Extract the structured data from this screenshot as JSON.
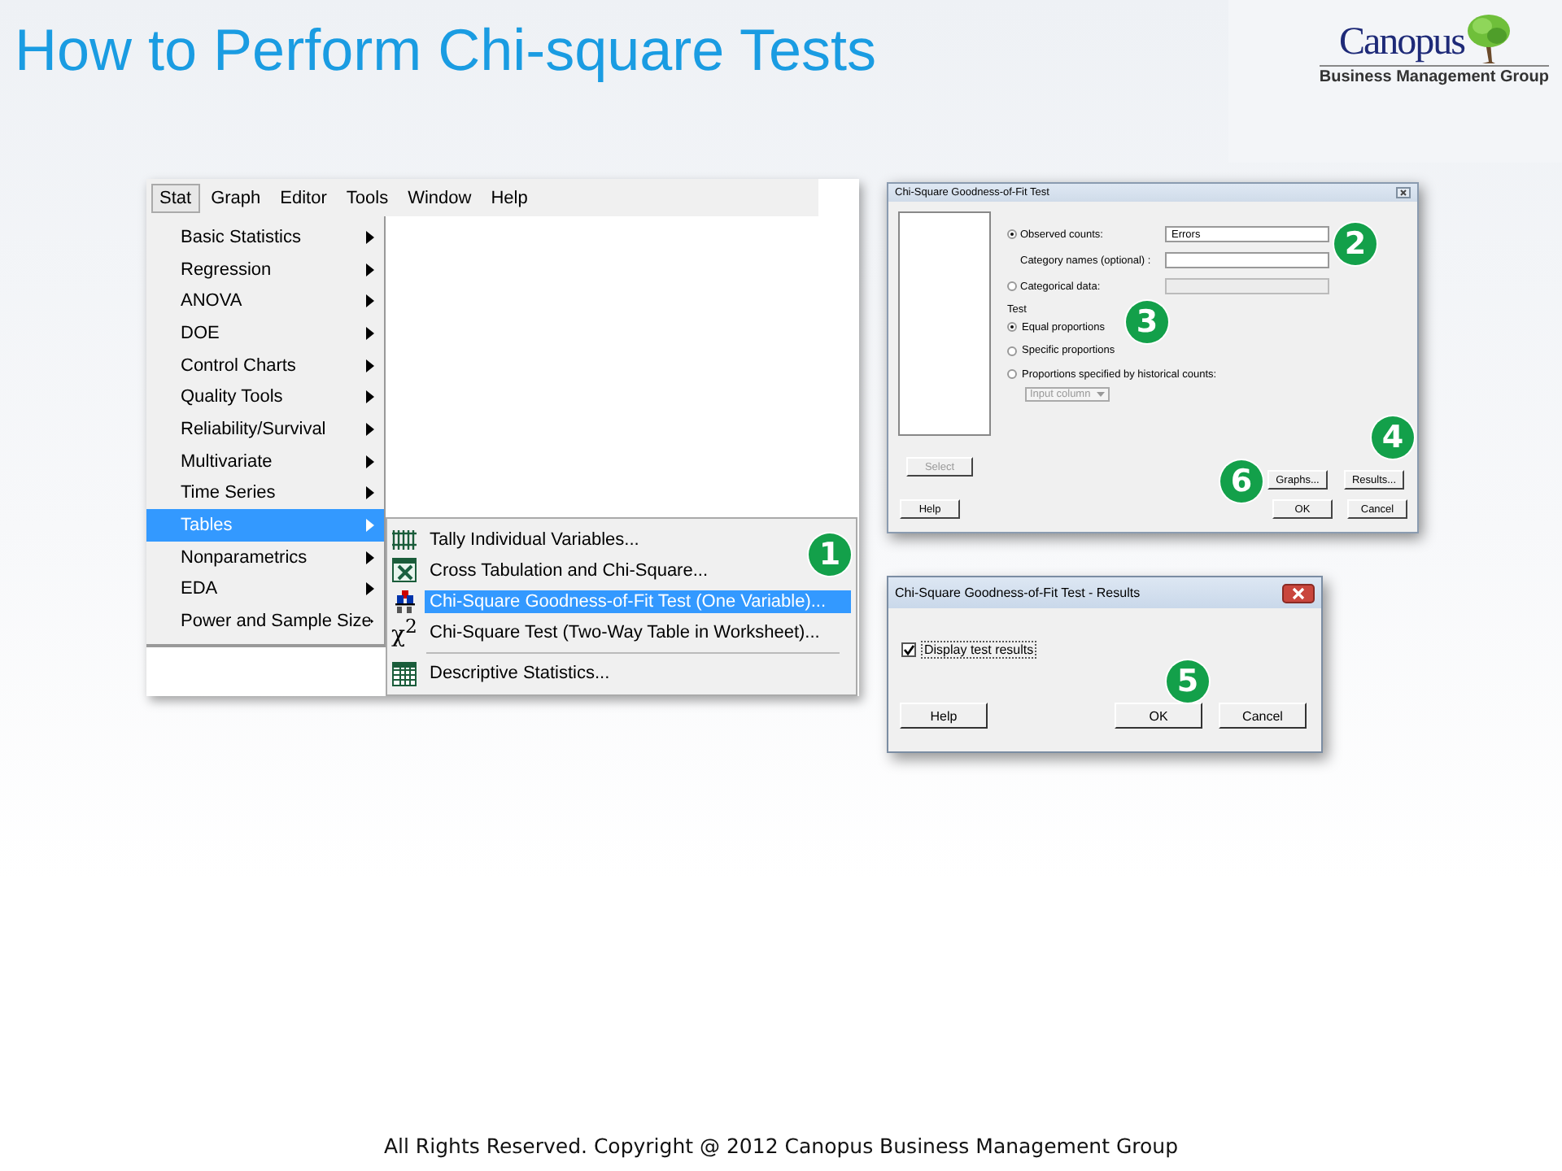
{
  "slide": {
    "title": "How to Perform Chi-square Tests",
    "logo": {
      "name": "Canopus",
      "tagline": "Business Management Group"
    },
    "footer": "All Rights Reserved. Copyright @ 2012  Canopus Business Management Group"
  },
  "menu_window": {
    "menubar": [
      {
        "label": "Stat",
        "selected": true
      },
      {
        "label": "Graph",
        "selected": false
      },
      {
        "label": "Editor",
        "selected": false
      },
      {
        "label": "Tools",
        "selected": false
      },
      {
        "label": "Window",
        "selected": false
      },
      {
        "label": "Help",
        "selected": false
      }
    ],
    "menu_items": [
      {
        "label": "Basic Statistics",
        "selected": false
      },
      {
        "label": "Regression",
        "selected": false
      },
      {
        "label": "ANOVA",
        "selected": false
      },
      {
        "label": "DOE",
        "selected": false
      },
      {
        "label": "Control Charts",
        "selected": false
      },
      {
        "label": "Quality Tools",
        "selected": false
      },
      {
        "label": "Reliability/Survival",
        "selected": false
      },
      {
        "label": "Multivariate",
        "selected": false
      },
      {
        "label": "Time Series",
        "selected": false
      },
      {
        "label": "Tables",
        "selected": true
      },
      {
        "label": "Nonparametrics",
        "selected": false
      },
      {
        "label": "EDA",
        "selected": false
      },
      {
        "label": "Power and Sample Size",
        "selected": false
      }
    ],
    "submenu_items": [
      {
        "kind": "item",
        "label": "Tally Individual Variables...",
        "selected": false
      },
      {
        "kind": "item",
        "label": "Cross Tabulation and Chi-Square...",
        "selected": false
      },
      {
        "kind": "item",
        "label": "Chi-Square Goodness-of-Fit Test (One Variable)...",
        "selected": true
      },
      {
        "kind": "item",
        "glyph": "χ$^{2}$",
        "label": "Chi-Square Test (Two-Way Table in Worksheet)...",
        "selected": false
      },
      {
        "kind": "separator"
      },
      {
        "kind": "item",
        "label": "Descriptive Statistics...",
        "selected": false
      }
    ]
  },
  "gof_dialog": {
    "title": "Chi-Square Goodness-of-Fit Test",
    "inputs": [
      {
        "kind": "radio",
        "label": "Observed counts:",
        "selected": true,
        "field": {
          "value": "Errors",
          "disabled": false
        }
      },
      {
        "kind": "label",
        "label": "Category names (optional) :",
        "field": {
          "disabled": false
        }
      },
      {
        "kind": "radio",
        "label": "Categorical data:",
        "selected": false,
        "field": {
          "disabled": true
        }
      }
    ],
    "test_label": "Test",
    "test_options": [
      {
        "label": "Equal proportions",
        "selected": true
      },
      {
        "label": "Specific proportions",
        "selected": false
      },
      {
        "label": "Proportions specified by historical counts:",
        "selected": false
      }
    ],
    "dropdown": {
      "value": "Input column",
      "disabled": true
    },
    "buttons": [
      {
        "label": "Select",
        "disabled": true
      },
      {
        "label": "Graphs...",
        "disabled": false
      },
      {
        "label": "Results...",
        "disabled": false
      },
      {
        "label": "Help",
        "disabled": false
      },
      {
        "label": "OK",
        "disabled": false
      },
      {
        "label": "Cancel",
        "disabled": false
      }
    ]
  },
  "results_dialog": {
    "title": "Chi-Square Goodness-of-Fit Test - Results",
    "checkbox": {
      "label": "Display test results",
      "checked": true
    },
    "buttons": [
      "Help",
      "OK",
      "Cancel"
    ]
  },
  "step_markers": [
    "1",
    "2",
    "3",
    "4",
    "5",
    "6"
  ]
}
